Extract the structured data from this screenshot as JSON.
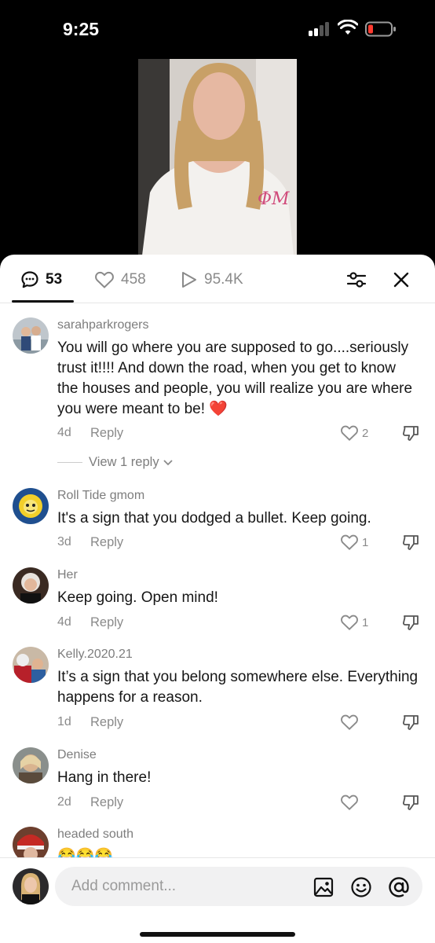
{
  "status_bar": {
    "time": "9:25"
  },
  "tabs": {
    "comments_count": "53",
    "likes_count": "458",
    "views_count": "95.4K"
  },
  "comments": [
    {
      "username": "sarahparkrogers",
      "text": "You will go where you are supposed to go....seriously trust it!!!! And down the road, when you get to know the houses and people, you will realize you are where you were meant to be! ❤️",
      "age": "4d",
      "reply_label": "Reply",
      "likes": "2",
      "view_replies": "View 1 reply"
    },
    {
      "username": "Roll Tide gmom",
      "text": "It's a sign that you dodged a bullet. Keep going.",
      "age": "3d",
      "reply_label": "Reply",
      "likes": "1"
    },
    {
      "username": "Her",
      "text": "Keep going. Open mind!",
      "age": "4d",
      "reply_label": "Reply",
      "likes": "1"
    },
    {
      "username": "Kelly.2020.21",
      "text": "It’s a sign that you belong somewhere else. Everything happens for a reason.",
      "age": "1d",
      "reply_label": "Reply",
      "likes": ""
    },
    {
      "username": "Denise",
      "text": "Hang in there!",
      "age": "2d",
      "reply_label": "Reply",
      "likes": ""
    },
    {
      "username": "headed south",
      "text": "😂😂😂"
    }
  ],
  "input": {
    "placeholder": "Add comment..."
  },
  "colors": {
    "like_heart_red": "#e0202a",
    "accent_text": "#161616",
    "muted": "#8a8a8a"
  }
}
